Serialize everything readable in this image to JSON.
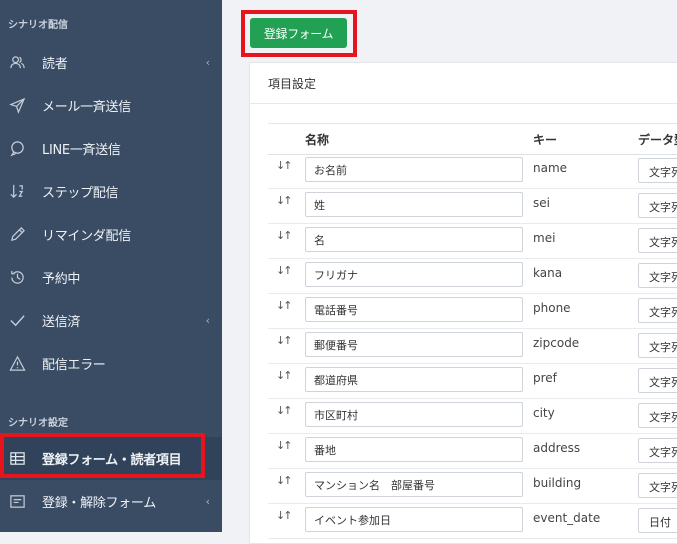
{
  "sidebar": {
    "section1_title": "シナリオ配信",
    "section2_title": "シナリオ設定",
    "items": [
      {
        "label": "読者",
        "icon": "users-icon",
        "chevron": "‹"
      },
      {
        "label": "メール一斉送信",
        "icon": "send-icon",
        "chevron": ""
      },
      {
        "label": "LINE一斉送信",
        "icon": "chat-bubble-icon",
        "chevron": ""
      },
      {
        "label": "ステップ配信",
        "icon": "sort-numeric-icon",
        "chevron": ""
      },
      {
        "label": "リマインダ配信",
        "icon": "pencil-icon",
        "chevron": ""
      },
      {
        "label": "予約中",
        "icon": "history-icon",
        "chevron": ""
      },
      {
        "label": "送信済",
        "icon": "check-icon",
        "chevron": "‹"
      },
      {
        "label": "配信エラー",
        "icon": "warning-icon",
        "chevron": ""
      },
      {
        "label": "登録フォーム・読者項目",
        "icon": "table-icon",
        "chevron": ""
      },
      {
        "label": "登録・解除フォーム",
        "icon": "form-icon",
        "chevron": "‹"
      }
    ]
  },
  "main": {
    "register_button": "登録フォーム",
    "panel_title": "項目設定",
    "columns": {
      "name": "名称",
      "key": "キー",
      "type": "データ型"
    },
    "rows": [
      {
        "name": "お名前",
        "key": "name",
        "type": "文字列"
      },
      {
        "name": "姓",
        "key": "sei",
        "type": "文字列"
      },
      {
        "name": "名",
        "key": "mei",
        "type": "文字列"
      },
      {
        "name": "フリガナ",
        "key": "kana",
        "type": "文字列"
      },
      {
        "name": "電話番号",
        "key": "phone",
        "type": "文字列"
      },
      {
        "name": "郵便番号",
        "key": "zipcode",
        "type": "文字列"
      },
      {
        "name": "都道府県",
        "key": "pref",
        "type": "文字列"
      },
      {
        "name": "市区町村",
        "key": "city",
        "type": "文字列"
      },
      {
        "name": "番地",
        "key": "address",
        "type": "文字列"
      },
      {
        "name": "マンション名　部屋番号",
        "key": "building",
        "type": "文字列"
      },
      {
        "name": "イベント参加日",
        "key": "event_date",
        "type": "日付"
      }
    ]
  },
  "colors": {
    "sidebar_bg": "#3a4c63",
    "accent_green": "#22a155",
    "highlight_red": "#e5141d"
  }
}
